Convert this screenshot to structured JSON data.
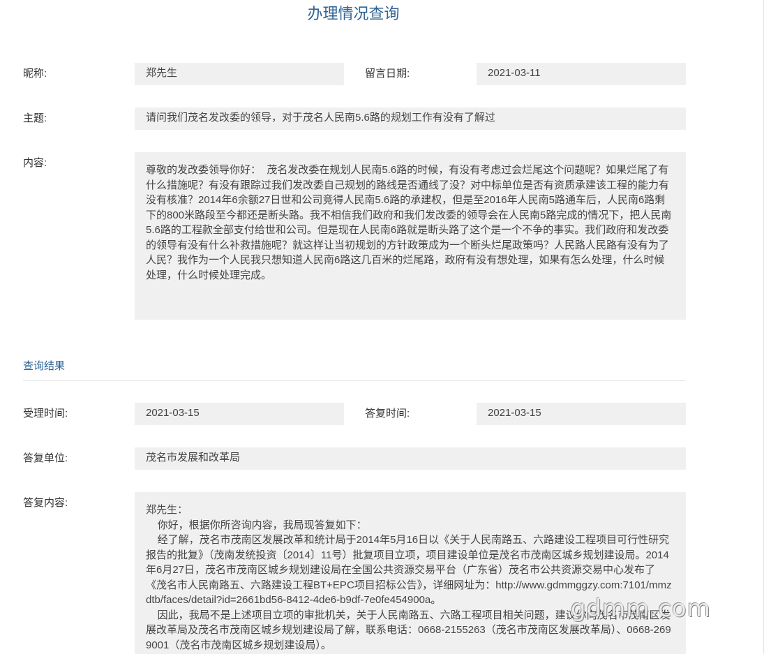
{
  "page_title": "办理情况查询",
  "nickname": {
    "label": "昵称:",
    "value": "郑先生"
  },
  "message_date": {
    "label": "留言日期:",
    "value": "2021-03-11"
  },
  "subject": {
    "label": "主题:",
    "value": "请问我们茂名发改委的领导，对于茂名人民南5.6路的规划工作有没有了解过"
  },
  "content": {
    "label": "内容:",
    "value": "尊敬的发改委领导你好：  茂名发改委在规划人民南5.6路的时候，有没有考虑过会烂尾这个问题呢？如果烂尾了有什么措施呢？有没有跟踪过我们发改委自己规划的路线是否通线了没？对中标单位是否有资质承建该工程的能力有没有核准？2014年6余额27日世和公司竞得人民南5.6路的承建权，但是至2016年人民南5路通车后，人民南6路剩下的800米路段至今都还是断头路。我不相信我们政府和我们发改委的领导会在人民南5路完成的情况下，把人民南5.6路的工程款全部支付给世和公司。但是现在人民南6路就是断头路了这个是一个不争的事实。我们政府和发改委的领导有没有什么补救措施呢？就这样让当初规划的方针政策成为一个断头烂尾政策吗？人民路人民路有没有为了人民？我作为一个人民我只想知道人民南6路这几百米的烂尾路，政府有没有想处理，如果有怎么处理，什么时候处理，什么时候处理完成。"
  },
  "results": {
    "section_title": "查询结果",
    "accept_time": {
      "label": "受理时间:",
      "value": "2021-03-15"
    },
    "reply_time": {
      "label": "答复时间:",
      "value": "2021-03-15"
    },
    "reply_unit": {
      "label": "答复单位:",
      "value": "茂名市发展和改革局"
    },
    "reply_content": {
      "label": "答复内容:",
      "value": "郑先生：\n    你好，根据你所咨询内容，我局现答复如下：\n    经了解，茂名市茂南区发展改革和统计局于2014年5月16日以《关于人民南路五、六路建设工程项目可行性研究报告的批复》（茂南发统投资〔2014〕11号）批复项目立项，项目建设单位是茂名市茂南区城乡规划建设局。2014年6月27日，茂名市茂南区城乡规划建设局在全国公共资源交易平台（广东省）茂名市公共资源交易中心发布了《茂名市人民南路五、六路建设工程BT+EPC项目招标公告》，详细网址为：http://www.gdmmggzy.com:7101/mmzdtb/faces/detail?id=2661bd56-8412-4de6-b9df-7e0fe454900a。\n    因此，我局不是上述项目立项的审批机关，关于人民南路五、六路工程项目相关问题，建议你向茂名市茂南区发展改革局及茂名市茂南区城乡规划建设局了解，联系电话：0668-2155263（茂名市茂南区发展改革局）、0668-2699001（茂名市茂南区城乡规划建设局）。"
    }
  },
  "watermark": "gdmm.com"
}
